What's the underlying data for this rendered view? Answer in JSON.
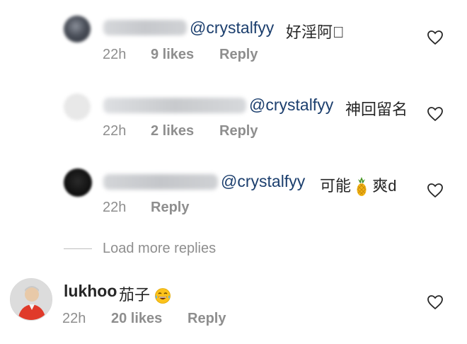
{
  "comments": [
    {
      "mention": "@crystalfyy",
      "text": "好淫阿\u0000",
      "time": "22h",
      "likes": "9 likes",
      "reply": "Reply"
    },
    {
      "mention": "@crystalfyy",
      "text": "神回留名",
      "time": "22h",
      "likes": "2 likes",
      "reply": "Reply"
    },
    {
      "mention": "@crystalfyy",
      "text_before": "可能",
      "text_after": "爽d",
      "time": "22h",
      "reply": "Reply"
    }
  ],
  "load_more": "Load more replies",
  "main_comment": {
    "username": "lukhoo",
    "text": "茄子",
    "time": "22h",
    "likes": "20 likes",
    "reply": "Reply"
  },
  "icons": {
    "like": "heart-outline-icon",
    "pineapple": "pineapple-emoji",
    "laugh": "tears-of-joy-emoji"
  },
  "colors": {
    "mention": "#1c3f6e",
    "meta": "#8e8e8e",
    "text": "#262626"
  }
}
